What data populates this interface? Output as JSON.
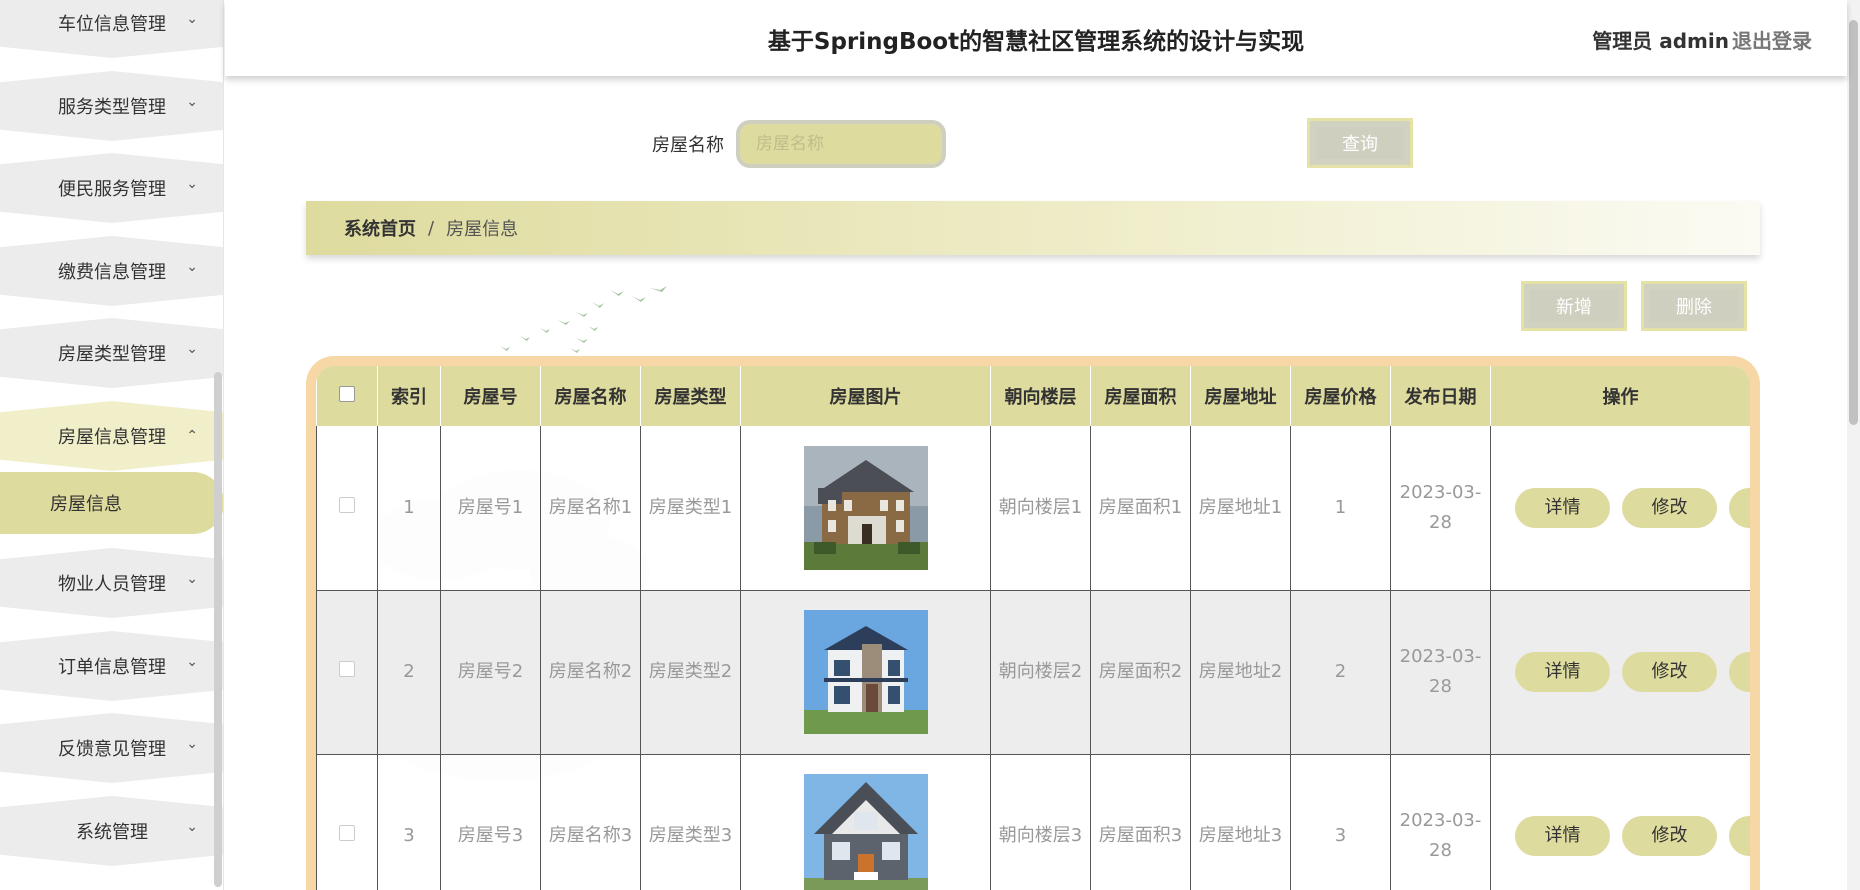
{
  "header": {
    "title": "基于SpringBoot的智慧社区管理系统的设计与实现",
    "user": "管理员 admin",
    "logout": "退出登录"
  },
  "sidebar": {
    "items": [
      {
        "label": "车位信息管理",
        "expanded": false
      },
      {
        "label": "服务类型管理",
        "expanded": false
      },
      {
        "label": "便民服务管理",
        "expanded": false
      },
      {
        "label": "缴费信息管理",
        "expanded": false
      },
      {
        "label": "房屋类型管理",
        "expanded": false
      },
      {
        "label": "房屋信息管理",
        "expanded": true
      },
      {
        "label": "物业人员管理",
        "expanded": false
      },
      {
        "label": "订单信息管理",
        "expanded": false
      },
      {
        "label": "反馈意见管理",
        "expanded": false
      },
      {
        "label": "系统管理",
        "expanded": false
      }
    ],
    "active_sub": "房屋信息",
    "chevron_down": "⌄",
    "chevron_up": "⌃"
  },
  "search": {
    "label": "房屋名称",
    "placeholder": "房屋名称",
    "query_button": "查询"
  },
  "breadcrumb": {
    "home": "系统首页",
    "separator": "/",
    "current": "房屋信息"
  },
  "actions": {
    "add": "新增",
    "delete": "删除"
  },
  "table": {
    "columns": [
      "索引",
      "房屋号",
      "房屋名称",
      "房屋类型",
      "房屋图片",
      "朝向楼层",
      "房屋面积",
      "房屋地址",
      "房屋价格",
      "发布日期",
      "操作"
    ],
    "rows": [
      {
        "index": "1",
        "number": "房屋号1",
        "name": "房屋名称1",
        "type": "房屋类型1",
        "image": "house-colonial",
        "floor": "朝向楼层1",
        "area": "房屋面积1",
        "address": "房屋地址1",
        "price": "1",
        "date": "2023-03-28"
      },
      {
        "index": "2",
        "number": "房屋号2",
        "name": "房屋名称2",
        "type": "房屋类型2",
        "image": "house-villa",
        "floor": "朝向楼层2",
        "area": "房屋面积2",
        "address": "房屋地址2",
        "price": "2",
        "date": "2023-03-28"
      },
      {
        "index": "3",
        "number": "房屋号3",
        "name": "房屋名称3",
        "type": "房屋类型3",
        "image": "house-gable",
        "floor": "朝向楼层3",
        "area": "房屋面积3",
        "address": "房屋地址3",
        "price": "3",
        "date": "2023-03-28"
      }
    ],
    "row_actions": {
      "detail": "详情",
      "edit": "修改"
    }
  },
  "colors": {
    "accent": "#dedb9e",
    "table_border": "#f6d7a5",
    "button_disabled": "#cfcfc0"
  }
}
